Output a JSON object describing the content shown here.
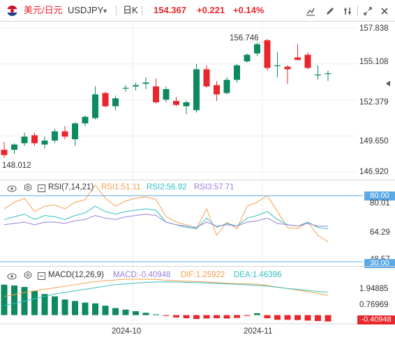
{
  "header": {
    "pair_cn": "美元/日元",
    "symbol": "USDJPY",
    "dropdown": "▾",
    "period": "日K",
    "price": "154.367",
    "change": "+0.221",
    "change_pct": "+0.14%",
    "icons": [
      "indicator-toggle-icon",
      "draw-icon",
      "settings-icon",
      "fullscreen-icon",
      "close-icon"
    ]
  },
  "colors": {
    "up": "#0e8a5f",
    "down": "#e8262b",
    "price_red": "#e8262b",
    "rsi1": "#f5a04a",
    "rsi2": "#35c0c4",
    "rsi3": "#9b7fd8",
    "dif": "#f5a04a",
    "dea": "#35c0c4",
    "hline": "#5aa8e6"
  },
  "price_panel": {
    "y_ticks": [
      "157.838",
      "155.108",
      "152.379",
      "149.650",
      "146.920"
    ],
    "high_label": "156.746",
    "low_label": "148.012",
    "right_icon": "crosshair-icon"
  },
  "rsi_panel": {
    "title": "RSI(7,14,21)",
    "rsi1": "RSI1:51.11",
    "rsi2": "RSI2:56.92",
    "rsi3": "RSI3:57.71",
    "y_labels": [
      "80.00",
      "80.01",
      "64.29",
      "48.57",
      "30.00"
    ]
  },
  "macd_panel": {
    "title": "MACD(12,26,9)",
    "macd": "MACD:-0.40948",
    "dif": "DIF:1.25922",
    "dea": "DEA:1.46396",
    "y_labels": [
      "1.94885",
      "0.76969",
      "-0.40948"
    ]
  },
  "x_axis": {
    "labels": [
      "2024-10",
      "2024-11"
    ]
  },
  "chart_data": [
    {
      "type": "candlestick",
      "title": "USDJPY 日K",
      "ylim": [
        146.92,
        157.838
      ],
      "y_ticks": [
        157.838,
        155.108,
        152.379,
        149.65,
        146.92
      ],
      "annotations": {
        "high": 156.746,
        "low": 148.012
      },
      "candles": [
        {
          "o": 148.6,
          "h": 149.2,
          "l": 148.0,
          "c": 148.2
        },
        {
          "o": 148.6,
          "h": 149.1,
          "l": 148.3,
          "c": 149.0
        },
        {
          "o": 149.1,
          "h": 149.9,
          "l": 148.9,
          "c": 149.6
        },
        {
          "o": 149.7,
          "h": 149.9,
          "l": 148.9,
          "c": 149.1
        },
        {
          "o": 149.0,
          "h": 149.6,
          "l": 148.7,
          "c": 149.3
        },
        {
          "o": 149.3,
          "h": 150.2,
          "l": 149.1,
          "c": 150.0
        },
        {
          "o": 150.0,
          "h": 150.4,
          "l": 149.4,
          "c": 149.6
        },
        {
          "o": 149.4,
          "h": 150.7,
          "l": 148.9,
          "c": 150.6
        },
        {
          "o": 150.6,
          "h": 151.2,
          "l": 150.4,
          "c": 151.1
        },
        {
          "o": 151.0,
          "h": 153.4,
          "l": 150.9,
          "c": 152.8
        },
        {
          "o": 152.9,
          "h": 153.0,
          "l": 151.8,
          "c": 151.9
        },
        {
          "o": 151.9,
          "h": 152.7,
          "l": 151.6,
          "c": 152.5
        },
        {
          "o": 153.3,
          "h": 153.5,
          "l": 153.0,
          "c": 153.3
        },
        {
          "o": 153.4,
          "h": 153.7,
          "l": 153.1,
          "c": 153.5
        },
        {
          "o": 153.6,
          "h": 154.1,
          "l": 153.2,
          "c": 153.7
        },
        {
          "o": 153.4,
          "h": 154.0,
          "l": 152.1,
          "c": 152.2
        },
        {
          "o": 152.4,
          "h": 153.4,
          "l": 152.2,
          "c": 153.2
        },
        {
          "o": 152.3,
          "h": 152.6,
          "l": 151.9,
          "c": 152.0
        },
        {
          "o": 151.9,
          "h": 152.3,
          "l": 151.3,
          "c": 152.2
        },
        {
          "o": 151.6,
          "h": 155.1,
          "l": 151.4,
          "c": 154.7
        },
        {
          "o": 154.7,
          "h": 155.0,
          "l": 153.3,
          "c": 153.4
        },
        {
          "o": 153.5,
          "h": 153.8,
          "l": 152.3,
          "c": 152.8
        },
        {
          "o": 152.9,
          "h": 154.1,
          "l": 152.8,
          "c": 153.9
        },
        {
          "o": 153.9,
          "h": 155.1,
          "l": 153.7,
          "c": 155.0
        },
        {
          "o": 155.3,
          "h": 155.9,
          "l": 155.2,
          "c": 155.8
        },
        {
          "o": 155.9,
          "h": 156.7,
          "l": 155.7,
          "c": 156.6
        },
        {
          "o": 156.9,
          "h": 157.0,
          "l": 154.6,
          "c": 154.8
        },
        {
          "o": 155.0,
          "h": 156.0,
          "l": 154.1,
          "c": 155.0
        },
        {
          "o": 154.9,
          "h": 155.0,
          "l": 153.6,
          "c": 154.7
        },
        {
          "o": 155.6,
          "h": 156.6,
          "l": 155.5,
          "c": 155.4
        },
        {
          "o": 155.8,
          "h": 156.0,
          "l": 154.7,
          "c": 154.8
        },
        {
          "o": 154.3,
          "h": 155.0,
          "l": 153.9,
          "c": 154.3
        },
        {
          "o": 154.4,
          "h": 154.6,
          "l": 153.8,
          "c": 154.4
        }
      ]
    },
    {
      "type": "line",
      "title": "RSI(7,14,21)",
      "ylim": [
        30,
        80
      ],
      "series": [
        {
          "name": "RSI1",
          "values": [
            70,
            75,
            78,
            68,
            72,
            73,
            70,
            75,
            77,
            88,
            78,
            72,
            76,
            78,
            79,
            77,
            64,
            60,
            58,
            55,
            70,
            50,
            60,
            55,
            72,
            75,
            80,
            68,
            56,
            55,
            60,
            50,
            45
          ]
        },
        {
          "name": "RSI2",
          "values": [
            62,
            64,
            66,
            62,
            65,
            64,
            62,
            65,
            67,
            72,
            68,
            66,
            68,
            69,
            70,
            69,
            60,
            58,
            56,
            55,
            63,
            56,
            59,
            57,
            63,
            65,
            68,
            62,
            58,
            57,
            60,
            56,
            55
          ]
        },
        {
          "name": "RSI3",
          "values": [
            58,
            59,
            60,
            58,
            60,
            60,
            59,
            61,
            62,
            65,
            63,
            62,
            64,
            65,
            66,
            65,
            60,
            58,
            57,
            56,
            60,
            57,
            58,
            57,
            60,
            61,
            63,
            59,
            58,
            57,
            59,
            57,
            57
          ]
        }
      ]
    },
    {
      "type": "bar",
      "title": "MACD(12,26,9)",
      "ylim": [
        -0.6,
        2.7
      ],
      "series": [
        {
          "name": "MACD",
          "values": [
            1.95,
            1.9,
            1.8,
            1.55,
            1.35,
            1.2,
            1.0,
            0.9,
            0.8,
            0.75,
            0.6,
            0.45,
            0.35,
            0.25,
            0.15,
            0.05,
            -0.05,
            -0.15,
            -0.2,
            -0.25,
            -0.22,
            -0.2,
            -0.22,
            -0.18,
            -0.05,
            0.12,
            -0.2,
            -0.3,
            -0.3,
            -0.32,
            -0.35,
            -0.38,
            -0.41
          ]
        },
        {
          "name": "DIF",
          "values": [
            1.2,
            1.3,
            1.45,
            1.55,
            1.65,
            1.75,
            1.85,
            1.95,
            2.05,
            2.15,
            2.2,
            2.25,
            2.3,
            2.3,
            2.3,
            2.28,
            2.24,
            2.2,
            2.17,
            2.15,
            2.12,
            2.08,
            2.05,
            2.02,
            2.0,
            1.98,
            1.9,
            1.8,
            1.7,
            1.6,
            1.5,
            1.4,
            1.26
          ]
        },
        {
          "name": "DEA",
          "values": [
            0.6,
            0.75,
            0.9,
            1.05,
            1.2,
            1.35,
            1.45,
            1.55,
            1.65,
            1.75,
            1.85,
            1.95,
            2.0,
            2.05,
            2.1,
            2.12,
            2.13,
            2.12,
            2.1,
            2.08,
            2.06,
            2.03,
            2.0,
            1.97,
            1.94,
            1.9,
            1.85,
            1.78,
            1.7,
            1.65,
            1.58,
            1.52,
            1.46
          ]
        }
      ]
    }
  ]
}
